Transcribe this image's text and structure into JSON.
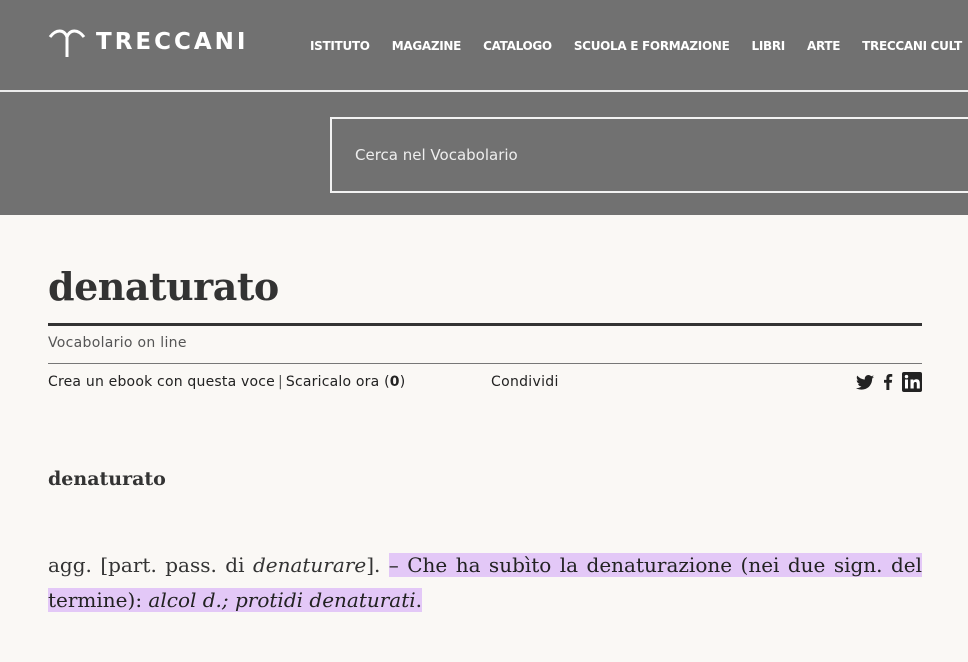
{
  "header": {
    "logo_text": "TRECCANI",
    "nav": [
      "ISTITUTO",
      "MAGAZINE",
      "CATALOGO",
      "SCUOLA E FORMAZIONE",
      "LIBRI",
      "ARTE",
      "TRECCANI CULT"
    ],
    "search_placeholder": "Cerca nel Vocabolario",
    "background_color": "#717171"
  },
  "article": {
    "title": "denaturato",
    "source": "Vocabolario on line",
    "toolbar": {
      "ebook_label": "Crea un ebook con questa voce",
      "separator": "|",
      "download_label": "Scaricalo ora",
      "download_count_open": "(",
      "download_count": "0",
      "download_count_close": ")",
      "share_label": "Condividi",
      "social_icons": [
        "twitter-icon",
        "facebook-icon",
        "linkedin-icon"
      ]
    },
    "headword": "denaturato",
    "definition": {
      "grammar": "agg. [part. pass. di ",
      "grammar_italic": "denaturare",
      "grammar_close": "].",
      "highlighted_text": "– Che ha subìto la denaturazione (nei due sign. del termine): ",
      "example_italic": "alcol d.; protidi denaturati",
      "end": ".",
      "highlight_color": "#e3c8f7"
    }
  }
}
